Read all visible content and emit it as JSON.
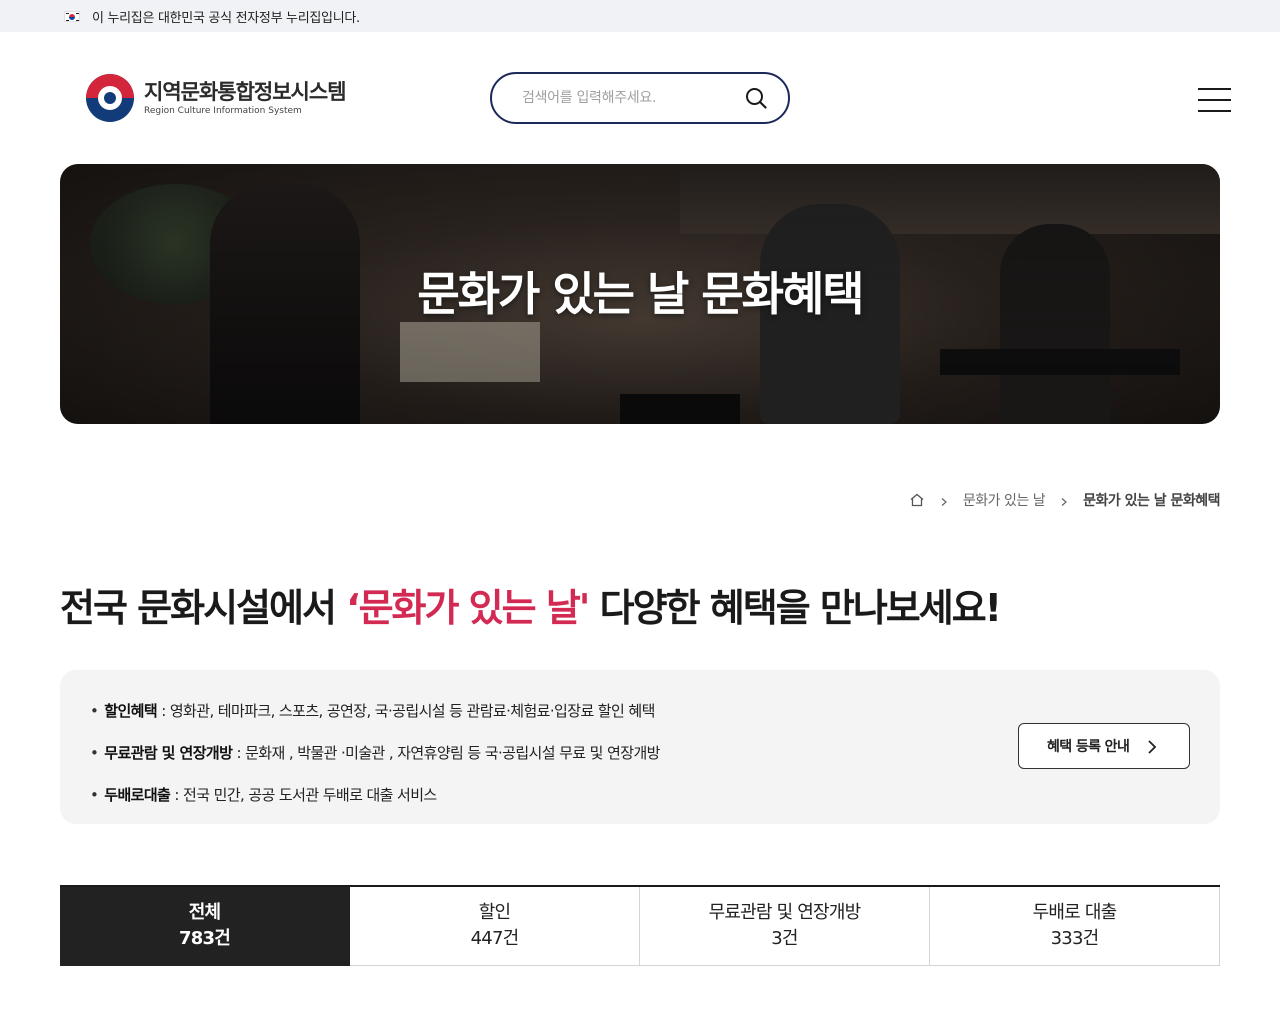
{
  "gov_banner": {
    "text": "이 누리집은 대한민국 공식 전자정부 누리집입니다."
  },
  "header": {
    "logo_title": "지역문화통합정보시스템",
    "logo_subtitle": "Region Culture Information System",
    "search_placeholder": "검색어를 입력해주세요.",
    "search_icon": "search-icon",
    "menu_icon": "hamburger-menu-icon"
  },
  "hero": {
    "title": "문화가 있는 날 문화혜택"
  },
  "breadcrumb": {
    "home_icon": "home-icon",
    "items": [
      "문화가 있는 날",
      "문화가 있는 날 문화혜택"
    ]
  },
  "headline": {
    "before": "전국 문화시설에서 ",
    "highlight": "‘문화가 있는 날'",
    "after": " 다양한 혜택을 만나보세요!",
    "highlight_color": "#d22a53"
  },
  "info": {
    "items": [
      {
        "label": "할인혜택",
        "text": " : 영화관, 테마파크, 스포츠, 공연장, 국·공립시설 등 관람료·체험료·입장료 할인 혜택"
      },
      {
        "label": "무료관람 및 연장개방",
        "text": " : 문화재 , 박물관 ·미술관 , 자연휴양림 등 국·공립시설 무료 및 연장개방"
      },
      {
        "label": "두배로대출",
        "text": " : 전국 민간, 공공 도서관 두배로 대출 서비스"
      }
    ],
    "button_label": "혜택 등록 안내"
  },
  "tabs": [
    {
      "label": "전체",
      "count": "783건",
      "active": true
    },
    {
      "label": "할인",
      "count": "447건",
      "active": false
    },
    {
      "label": "무료관람 및 연장개방",
      "count": "3건",
      "active": false
    },
    {
      "label": "두배로 대출",
      "count": "333건",
      "active": false
    }
  ]
}
